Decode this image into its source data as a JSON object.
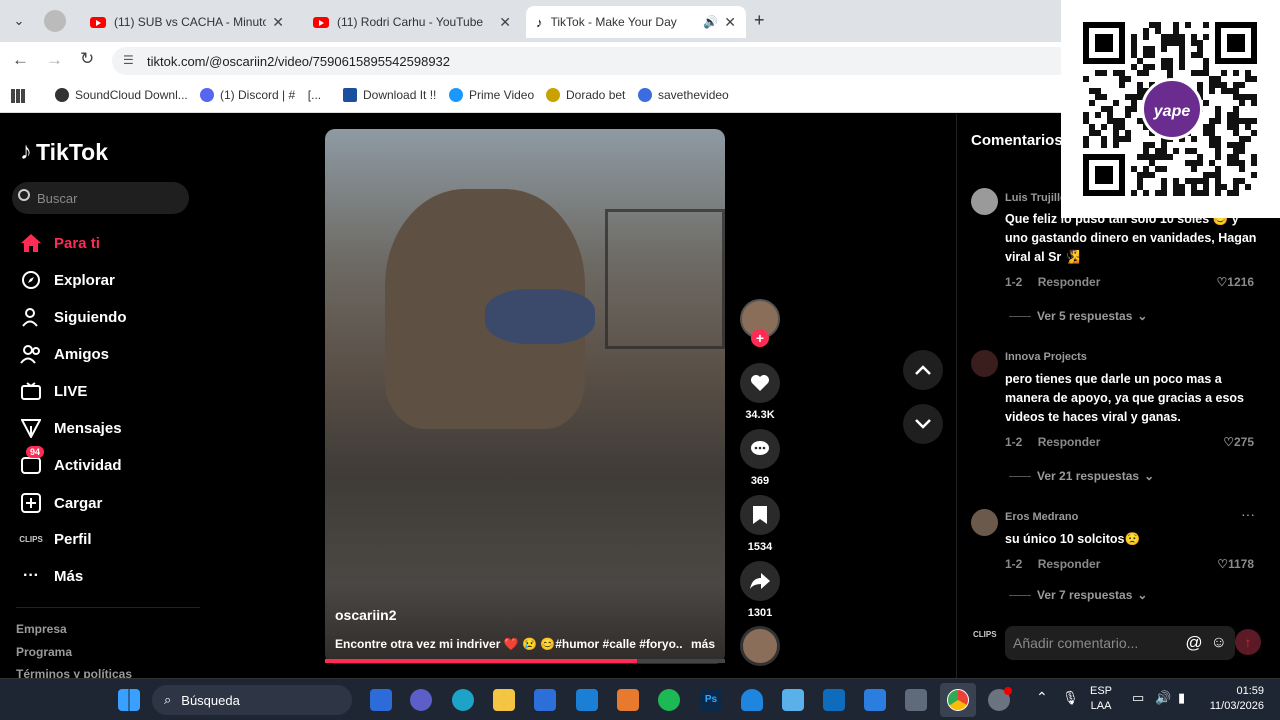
{
  "browser": {
    "tabs": [
      {
        "title": "(11) SUB vs CACHA - Minuto de",
        "icon": "youtube-icon"
      },
      {
        "title": "(11) Rodri Carhu - YouTube",
        "icon": "youtube-icon"
      },
      {
        "title": "TikTok - Make Your Day",
        "icon": "tiktok-icon"
      }
    ],
    "url": "tiktok.com/@oscariin2/video/7590615895542598932",
    "bookmarks": [
      {
        "label": "SoundCloud Downl...",
        "color": "#333333"
      },
      {
        "label": "(1) Discord | #   [...",
        "color": "#5865f2"
      },
      {
        "label": "Download It !!",
        "color": "#1a4fa0"
      },
      {
        "label": "Prime Video",
        "color": "#1a98ff"
      },
      {
        "label": "Dorado bet",
        "color": "#c9a100"
      },
      {
        "label": "savethevideo",
        "color": "#3b6de0"
      }
    ]
  },
  "tiktok": {
    "brand": "TikTok",
    "search_placeholder": "Buscar",
    "nav": [
      {
        "label": "Para ti"
      },
      {
        "label": "Explorar"
      },
      {
        "label": "Siguiendo"
      },
      {
        "label": "Amigos"
      },
      {
        "label": "LIVE"
      },
      {
        "label": "Mensajes"
      },
      {
        "label": "Actividad",
        "badge": "94"
      },
      {
        "label": "Cargar"
      },
      {
        "label": "Perfil"
      },
      {
        "label": "Más"
      }
    ],
    "footer": [
      "Empresa",
      "Programa",
      "Términos y políticas"
    ],
    "video": {
      "username": "oscariin2",
      "caption": "Encontre otra vez mi indriver ❤️ 😢 😊#humor #calle #foryo...",
      "more": "más",
      "progress": 0.78
    },
    "actions": {
      "likes": "34.3K",
      "comments": "369",
      "saves": "1534",
      "shares": "1301"
    },
    "comments_title": "Comentarios",
    "comments": [
      {
        "name": "Luis Trujillo",
        "text": "Que feliz lo puso tan solo 10 soles 😊 y uno gastando dinero en vanidades, Hagan viral al Sr 🧏",
        "date": "1-2",
        "reply": "Responder",
        "likes": "1216",
        "replies": "Ver 5 respuestas"
      },
      {
        "name": "Innova Projects",
        "text": "pero tienes que darle un poco mas a manera de apoyo, ya que gracias a esos videos te haces viral y ganas.",
        "date": "1-2",
        "reply": "Responder",
        "likes": "275",
        "replies": "Ver 21 respuestas"
      },
      {
        "name": "Eros Medrano",
        "text": "su único 10 solcitos😟",
        "date": "1-2",
        "reply": "Responder",
        "likes": "1178",
        "replies": "Ver 7 respuestas"
      }
    ],
    "comment_placeholder": "Añadir comentario..."
  },
  "qr": {
    "brand": "yape"
  },
  "taskbar": {
    "search": "Búsqueda",
    "lang": "ESP",
    "lang2": "LAA",
    "time": "01:59",
    "date": "11/03/2026"
  }
}
